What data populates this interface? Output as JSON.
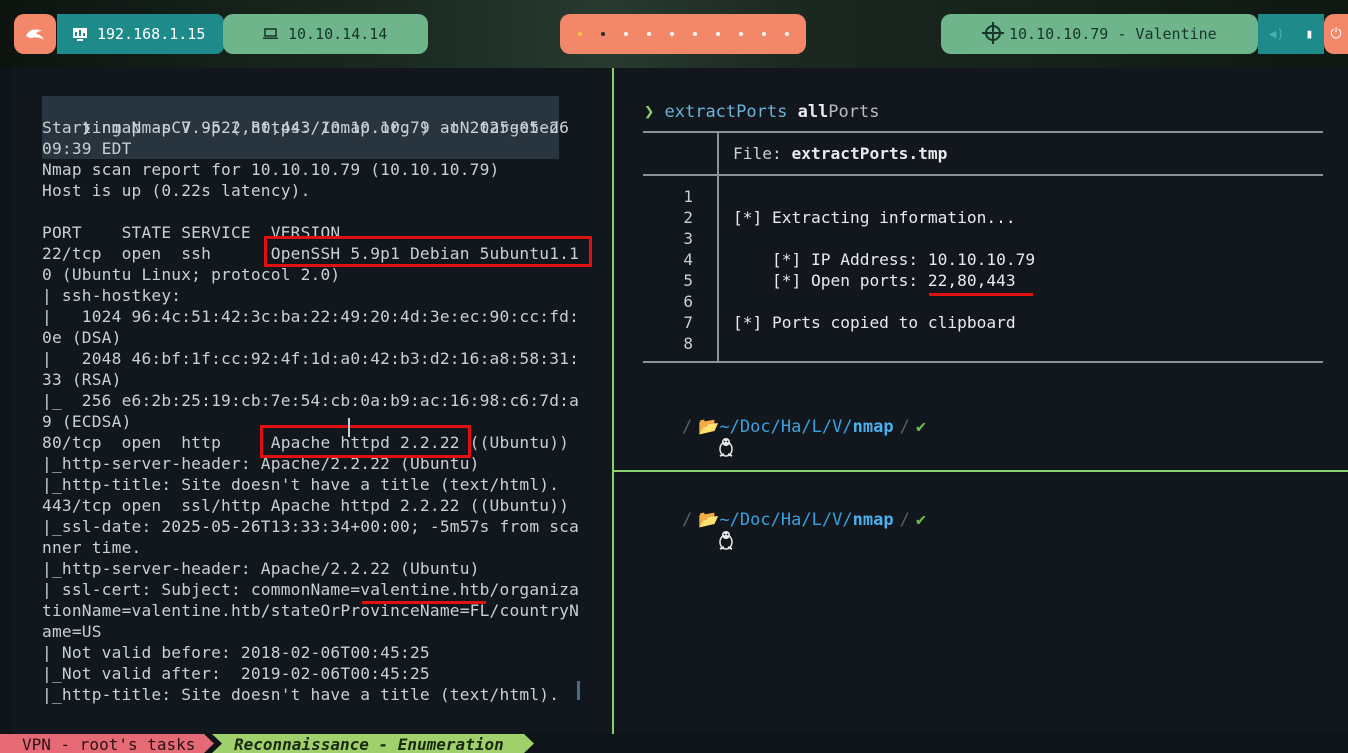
{
  "topbar": {
    "local_ip": "192.168.1.15",
    "vpn_ip": "10.10.14.14",
    "target": "10.10.10.79 - Valentine",
    "workspaces": 10,
    "active_workspace": 2
  },
  "left_terminal": {
    "lines": [
      "❯ nmap -sCV -p22,80,443 10.10.10.79 -oN targeted",
      "Starting Nmap 7.95 ( https://nmap.org ) at 2025-05-26",
      "09:39 EDT",
      "Nmap scan report for 10.10.10.79 (10.10.10.79)",
      "Host is up (0.22s latency).",
      "",
      "PORT    STATE SERVICE  VERSION",
      "22/tcp  open  ssh      OpenSSH 5.9p1 Debian 5ubuntu1.1",
      "0 (Ubuntu Linux; protocol 2.0)",
      "| ssh-hostkey:",
      "|   1024 96:4c:51:42:3c:ba:22:49:20:4d:3e:ec:90:cc:fd:",
      "0e (DSA)",
      "|   2048 46:bf:1f:cc:92:4f:1d:a0:42:b3:d2:16:a8:58:31:",
      "33 (RSA)",
      "|_  256 e6:2b:25:19:cb:7e:54:cb:0a:b9:ac:16:98:c6:7d:a",
      "9 (ECDSA)",
      "80/tcp  open  http     Apache httpd 2.2.22 ((Ubuntu))",
      "|_http-server-header: Apache/2.2.22 (Ubuntu)",
      "|_http-title: Site doesn't have a title (text/html).",
      "443/tcp open  ssl/http Apache httpd 2.2.22 ((Ubuntu))",
      "|_ssl-date: 2025-05-26T13:33:34+00:00; -5m57s from sca",
      "nner time.",
      "|_http-server-header: Apache/2.2.22 (Ubuntu)",
      "| ssl-cert: Subject: commonName=valentine.htb/organiza",
      "tionName=valentine.htb/stateOrProvinceName=FL/countryN",
      "ame=US",
      "| Not valid before: 2018-02-06T00:45:25",
      "|_Not valid after:  2019-02-06T00:45:25",
      "|_http-title: Site doesn't have a title (text/html)."
    ]
  },
  "right_terminal": {
    "prompt_arrow": "❯",
    "command": "extractPorts",
    "arg_bold": "all",
    "arg_rest": "Ports",
    "file_label": "File: ",
    "file_name": "extractPorts.tmp",
    "line_numbers": [
      "1",
      "2",
      "3",
      "4",
      "5",
      "6",
      "7",
      "8"
    ],
    "file_lines": [
      "",
      "[*] Extracting information...",
      "",
      "    [*] IP Address: 10.10.10.79",
      "    [*] Open ports: 22,80,443",
      "",
      "[*] Ports copied to clipboard",
      ""
    ],
    "prompt": {
      "home": "~/",
      "path_parts": [
        "Doc",
        "Ha",
        "L",
        "V"
      ],
      "current": "nmap",
      "check": "✔"
    }
  },
  "statusbar": {
    "session": "VPN - root's tasks",
    "task": "Reconnaissance - Enumeration"
  }
}
